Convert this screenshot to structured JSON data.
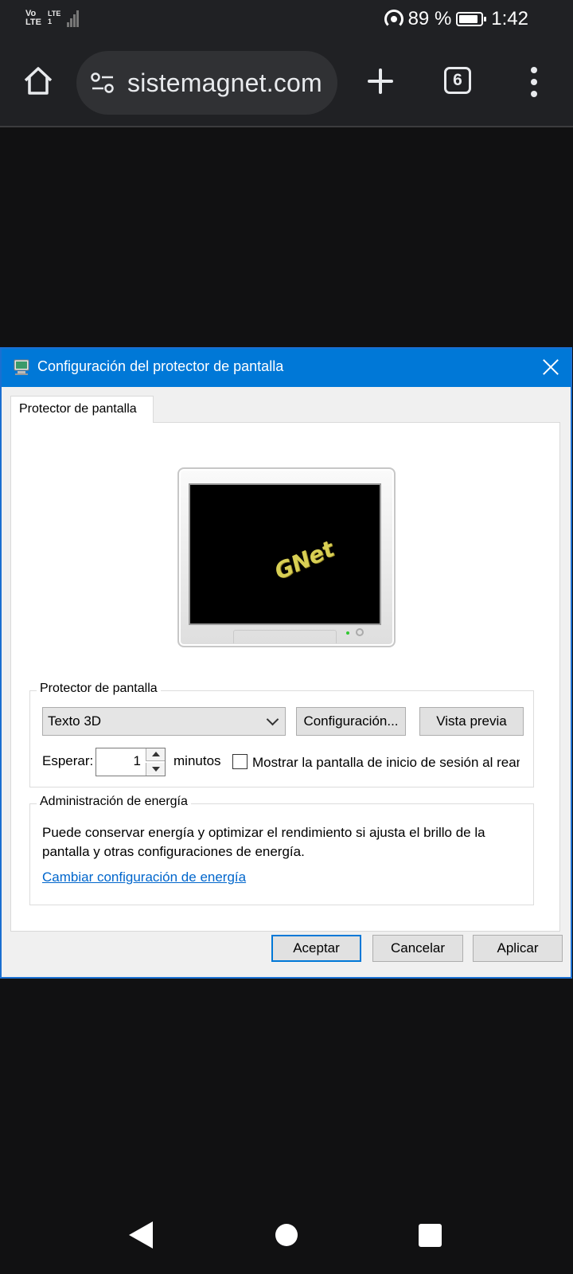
{
  "status_bar": {
    "network_line1": "Vo",
    "network_line2": "LTE",
    "lte2_line1": "LTE",
    "lte2_line2": "1",
    "battery_percent": "89 %",
    "battery_level": 0.89,
    "time": "1:42"
  },
  "browser": {
    "url": "sistemagnet.com",
    "tab_count": "6",
    "icons": [
      "home-icon",
      "site-settings-icon",
      "new-tab-icon",
      "tab-switcher-icon",
      "more-menu-icon"
    ]
  },
  "dialog": {
    "title": "Configuración del protector de pantalla",
    "tab_label": "Protector de pantalla",
    "preview_text": "GNet",
    "screensaver_group": {
      "legend": "Protector de pantalla",
      "selected": "Texto 3D",
      "config_button": "Configuración...",
      "preview_button": "Vista previa",
      "wait_label": "Esperar:",
      "wait_value": "1",
      "minutes_label": "minutos",
      "logon_checkbox_label": "Mostrar la pantalla de inicio de sesión al reanudar",
      "logon_checked": false
    },
    "energy_group": {
      "legend": "Administración de energía",
      "text": "Puede conservar energía y optimizar el rendimiento si ajusta el brillo de la pantalla y otras configuraciones de energía.",
      "link": "Cambiar configuración de energía"
    },
    "buttons": {
      "ok": "Aceptar",
      "cancel": "Cancelar",
      "apply": "Aplicar"
    }
  },
  "colors": {
    "titlebar": "#0078d7",
    "link": "#0066cc",
    "browser_bg": "#202124",
    "page_bg": "#111112"
  }
}
